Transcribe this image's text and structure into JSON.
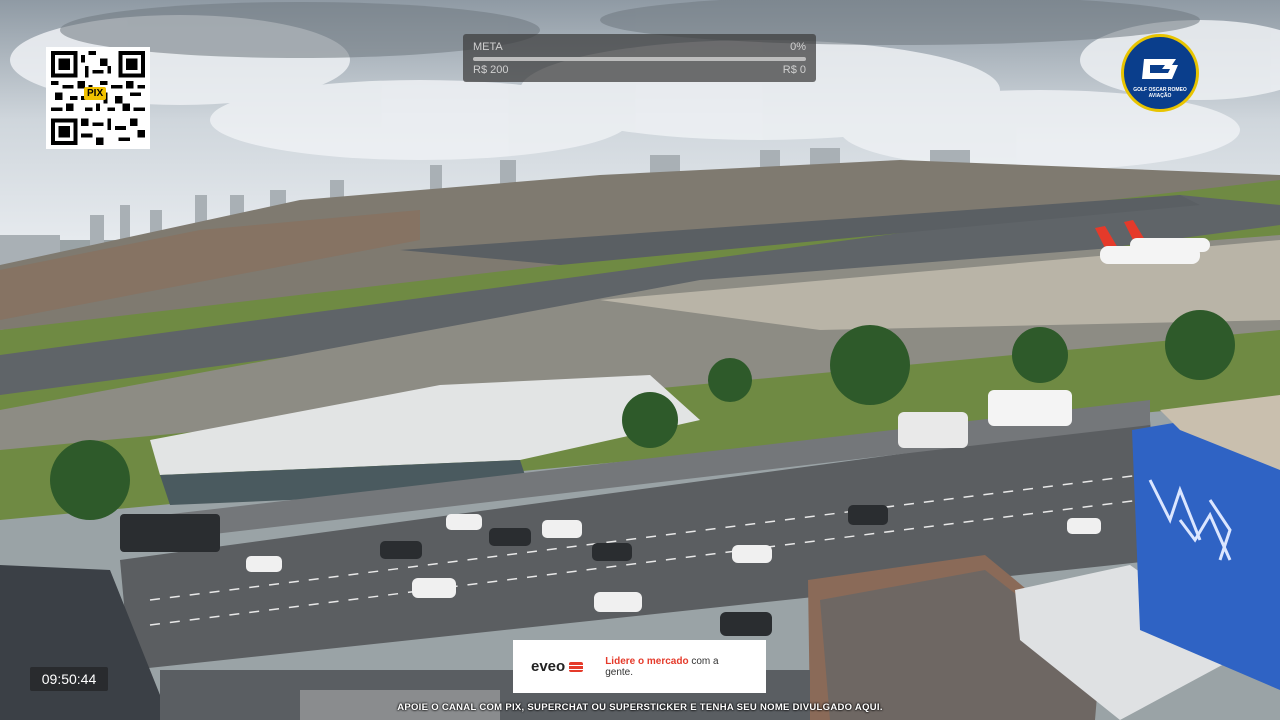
{
  "overlay": {
    "qr": {
      "label": "PIX",
      "icon": "qr-code-icon"
    },
    "meta": {
      "title": "META",
      "percent_label": "0%",
      "progress_fraction": 0.0,
      "goal_label": "R$ 200",
      "current_label": "R$ 0"
    },
    "logo": {
      "text": "GOLF OSCAR ROMEO AVIAÇÃO",
      "icon": "golf-oscar-romeo-logo-icon",
      "colors": {
        "bg": "#0a3e8c",
        "ring": "#e8c400"
      }
    },
    "clock": {
      "time": "09:50:44"
    },
    "sponsor": {
      "brand": "eveo",
      "message_prefix": "Lidere o mercado",
      "message_suffix": "com a gente.",
      "accent": "#e53a2a"
    },
    "ticker": {
      "text": "APOIE O CANAL COM PIX, SUPERCHAT OU SUPERSTICKER E TENHA SEU NOME DIVULGADO AQUI."
    }
  }
}
